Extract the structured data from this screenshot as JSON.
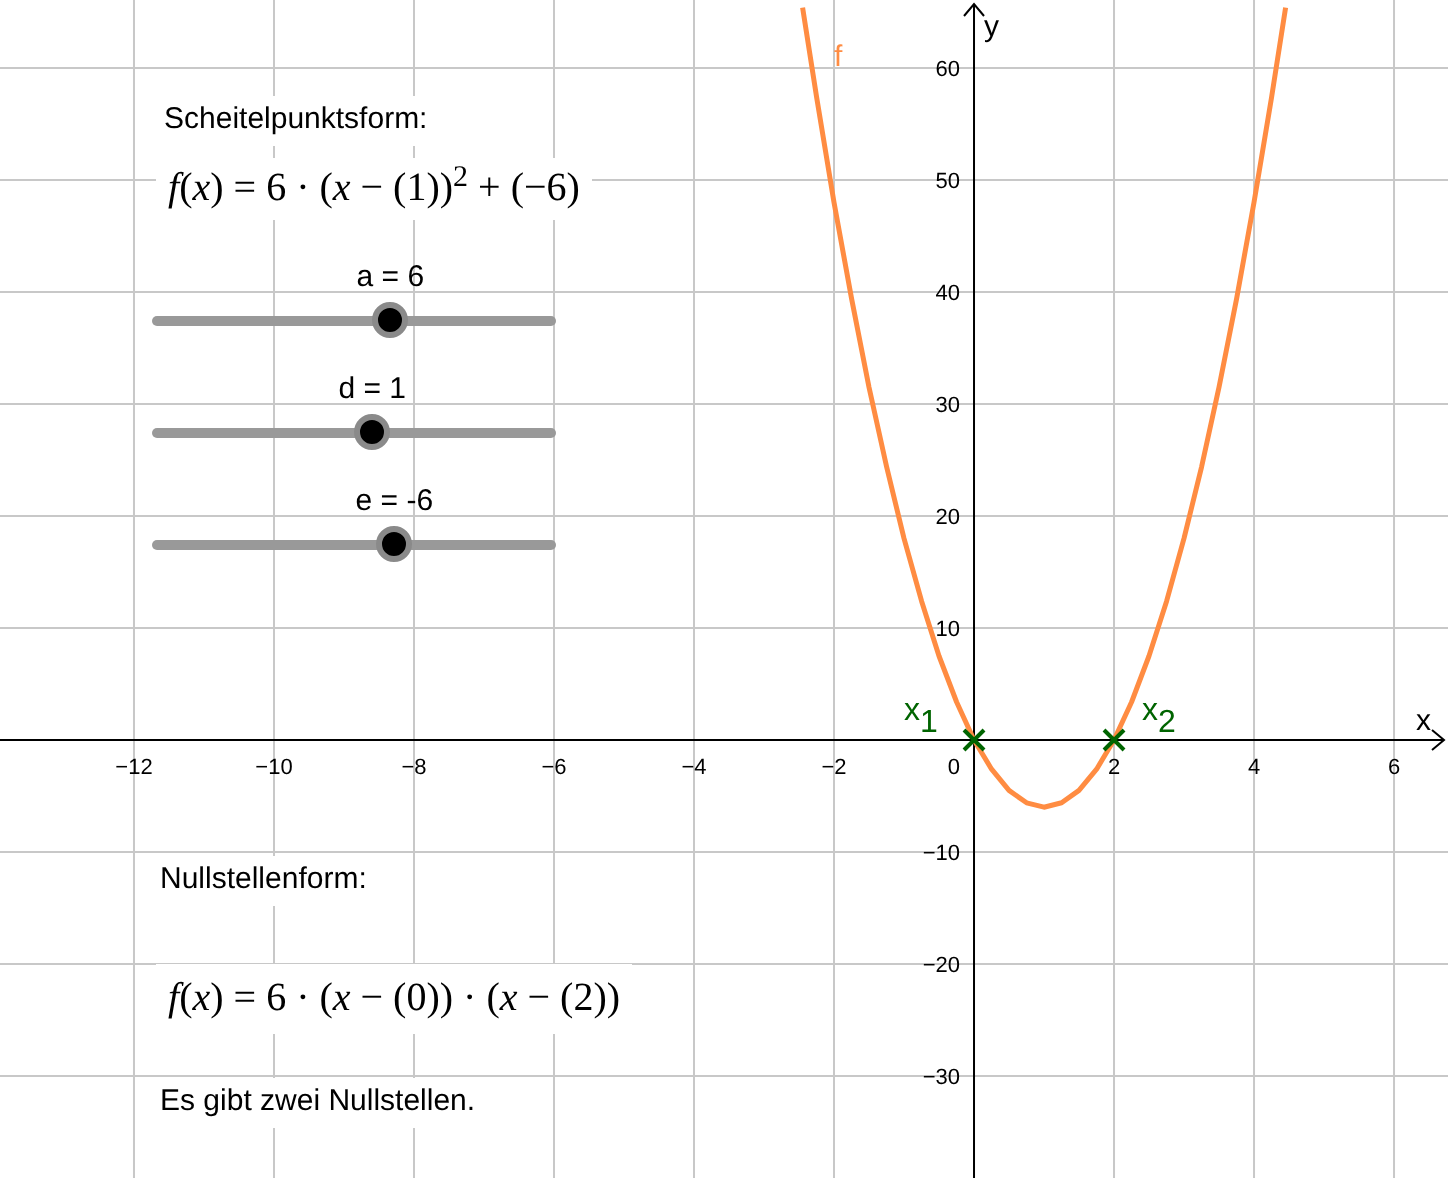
{
  "panel": {
    "vertex_form": {
      "heading": "Scheitelpunktsform:",
      "formula": "*f*(*x*) = 6 · (*x* − (1))$^{2}$ + (−6)"
    },
    "sliders": [
      {
        "label": "a = 6",
        "level": 0.59
      },
      {
        "label": "d = 1",
        "level": 0.545
      },
      {
        "label": "e = -6",
        "level": 0.6
      }
    ],
    "root_form": {
      "heading": "Nullstellenform:",
      "formula": "*f*(*x*) = 6 · (*x* − (0)) · (*x* − (2))",
      "note": "Es gibt zwei Nullstellen."
    }
  },
  "graph": {
    "chart_data": {
      "type": "line",
      "grid": true,
      "xlabel": "x",
      "ylabel": "y",
      "xlim": [
        -13.914,
        6.771
      ],
      "ylim": [
        -39.107,
        66.071
      ],
      "x": [
        -2.45,
        -2.25,
        -2,
        -1.75,
        -1.5,
        -1.25,
        -1,
        -0.75,
        -0.5,
        -0.25,
        0,
        0.25,
        0.5,
        0.75,
        1,
        1.25,
        1.5,
        1.75,
        2,
        2.25,
        2.5,
        2.75,
        3,
        3.25,
        3.5,
        3.75,
        4,
        4.25,
        4.45
      ],
      "series": [
        {
          "name": "f",
          "color": "#ff8c42",
          "values": [
            65.4,
            57.4,
            48,
            39.4,
            31.5,
            24.4,
            18,
            12.4,
            7.5,
            3.4,
            0,
            -2.6,
            -4.5,
            -5.6,
            -6,
            -5.6,
            -4.5,
            -2.6,
            0,
            3.4,
            7.5,
            12.4,
            18,
            24.4,
            31.5,
            39.4,
            48,
            57.4,
            65.4
          ]
        }
      ],
      "xticks": [
        {
          "value": -12,
          "label": "−12"
        },
        {
          "value": -10,
          "label": "−10"
        },
        {
          "value": -8,
          "label": "−8"
        },
        {
          "value": -6,
          "label": "−6"
        },
        {
          "value": -4,
          "label": "−4"
        },
        {
          "value": -2,
          "label": "−2"
        },
        {
          "value": 2,
          "label": "2"
        },
        {
          "value": 4,
          "label": "4"
        },
        {
          "value": 6,
          "label": "6"
        }
      ],
      "yticks": [
        {
          "value": -30,
          "label": "−30"
        },
        {
          "value": -20,
          "label": "−20"
        },
        {
          "value": -10,
          "label": "−10"
        },
        {
          "value": 10,
          "label": "10"
        },
        {
          "value": 20,
          "label": "20"
        },
        {
          "value": 30,
          "label": "30"
        },
        {
          "value": 40,
          "label": "40"
        },
        {
          "value": 50,
          "label": "50"
        },
        {
          "value": 60,
          "label": "60"
        }
      ]
    },
    "origin_label": "0",
    "points": [
      {
        "label": "x",
        "subscript": "1"
      },
      {
        "label": "x",
        "subscript": "2"
      }
    ]
  }
}
